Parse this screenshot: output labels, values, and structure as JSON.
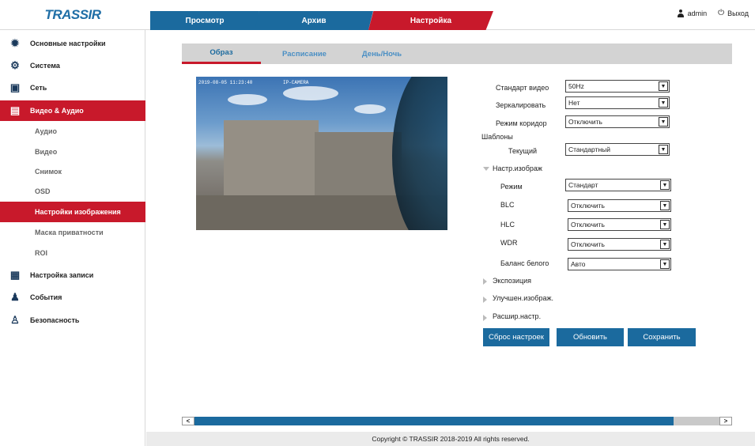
{
  "header": {
    "logo": "TRASSIR",
    "tabs": [
      {
        "label": "Просмотр"
      },
      {
        "label": "Архив"
      },
      {
        "label": "Настройка"
      }
    ],
    "user": "admin",
    "logout": "Выход"
  },
  "sidebar": {
    "items": [
      {
        "label": "Основные настройки",
        "icon": "gear-icon"
      },
      {
        "label": "Система",
        "icon": "gears-icon"
      },
      {
        "label": "Сеть",
        "icon": "network-icon"
      },
      {
        "label": "Видео & Аудио",
        "icon": "video-icon"
      },
      {
        "label": "Аудио"
      },
      {
        "label": "Видео"
      },
      {
        "label": "Снимок"
      },
      {
        "label": "OSD"
      },
      {
        "label": "Настройки изображения"
      },
      {
        "label": "Маска приватности"
      },
      {
        "label": "ROI"
      },
      {
        "label": "Настройка записи",
        "icon": "save-icon"
      },
      {
        "label": "События",
        "icon": "bell-icon"
      },
      {
        "label": "Безопасность",
        "icon": "user-icon"
      }
    ]
  },
  "subtabs": [
    {
      "label": "Образ"
    },
    {
      "label": "Расписание"
    },
    {
      "label": "День/Ночь"
    }
  ],
  "preview": {
    "osd_left": "2019-08-05 11:23:40",
    "osd_right": "IP-CAMERA"
  },
  "form": {
    "video_standard": {
      "label": "Стандарт видео",
      "value": "50Hz"
    },
    "mirror": {
      "label": "Зеркалировать",
      "value": "Нет"
    },
    "corridor": {
      "label": "Режим коридор",
      "value": "Отключить"
    },
    "templates": {
      "label": "Шаблоны"
    },
    "current": {
      "label": "Текущий",
      "value": "Стандартный"
    },
    "image_settings": {
      "label": "Настр.изображ"
    },
    "mode": {
      "label": "Режим",
      "value": "Стандарт"
    },
    "blc": {
      "label": "BLC",
      "value": "Отключить"
    },
    "hlc": {
      "label": "HLC",
      "value": "Отключить"
    },
    "wdr": {
      "label": "WDR",
      "value": "Отключить"
    },
    "wb": {
      "label": "Баланс белого",
      "value": "Авто"
    },
    "exposure": {
      "label": "Экспозиция"
    },
    "enhance": {
      "label": "Улучшен.изображ."
    },
    "advanced": {
      "label": "Расшир.настр."
    }
  },
  "buttons": {
    "reset": "Сброс настроек",
    "refresh": "Обновить",
    "save": "Сохранить"
  },
  "scroll": {
    "left": "<",
    "right": ">"
  },
  "footer": "Copyright © TRASSIR 2018-2019 All rights reserved.",
  "colors": {
    "accent": "#c8192b",
    "primary": "#1b6a9e"
  }
}
